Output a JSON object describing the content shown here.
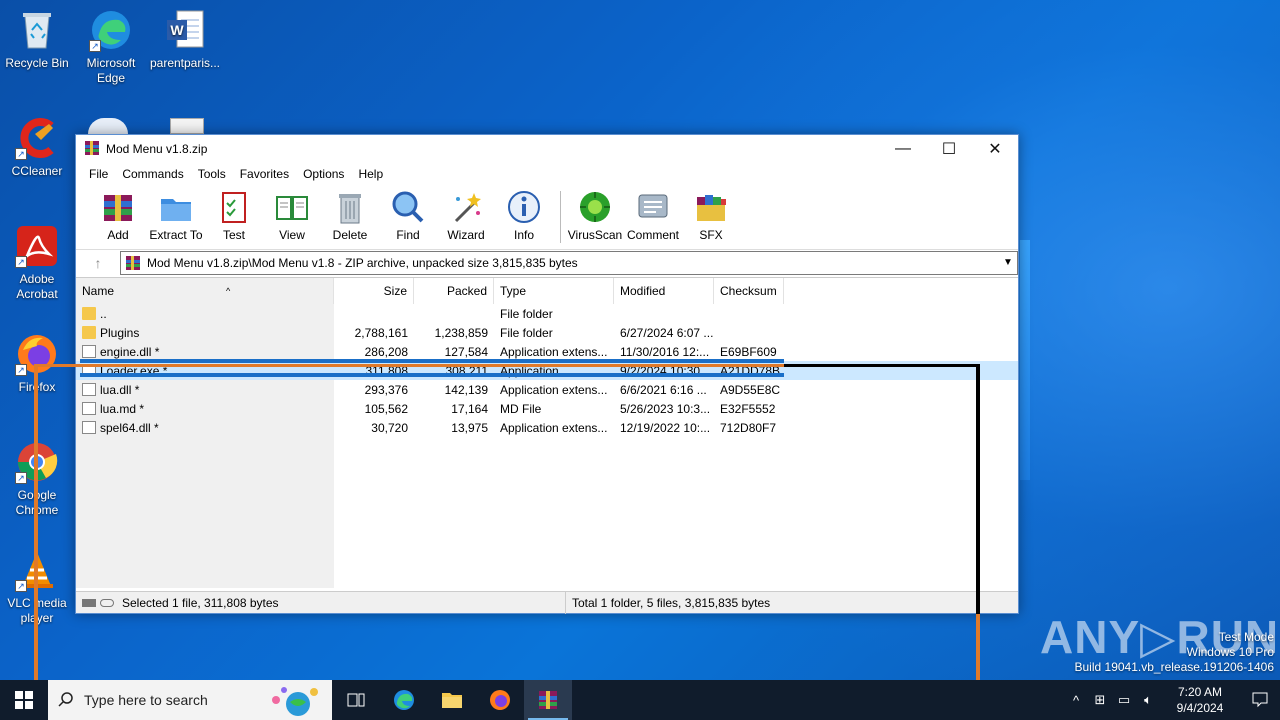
{
  "desktop": {
    "icons": [
      {
        "label": "Recycle Bin",
        "icon": "recycle-bin-icon"
      },
      {
        "label": "Microsoft Edge",
        "icon": "edge-icon"
      },
      {
        "label": "parentparis...",
        "icon": "word-doc-icon"
      },
      {
        "label": "CCleaner",
        "icon": "ccleaner-icon"
      },
      {
        "label": "Adobe Acrobat",
        "icon": "acrobat-icon"
      },
      {
        "label": "Firefox",
        "icon": "firefox-icon"
      },
      {
        "label": "Google Chrome",
        "icon": "chrome-icon"
      },
      {
        "label": "VLC media player",
        "icon": "vlc-icon"
      }
    ]
  },
  "window": {
    "title": "Mod Menu v1.8.zip",
    "controls": {
      "minimize": "—",
      "maximize": "☐",
      "close": "✕"
    },
    "menu": [
      "File",
      "Commands",
      "Tools",
      "Favorites",
      "Options",
      "Help"
    ],
    "toolbar": [
      "Add",
      "Extract To",
      "Test",
      "View",
      "Delete",
      "Find",
      "Wizard",
      "Info",
      "VirusScan",
      "Comment",
      "SFX"
    ],
    "address": "Mod Menu v1.8.zip\\Mod Menu v1.8 - ZIP archive, unpacked size 3,815,835 bytes",
    "columns": [
      "Name",
      "Size",
      "Packed",
      "Type",
      "Modified",
      "Checksum"
    ],
    "rows": [
      {
        "name": "..",
        "size": "",
        "packed": "",
        "type": "File folder",
        "modified": "",
        "checksum": "",
        "kind": "folder"
      },
      {
        "name": "Plugins",
        "size": "2,788,161",
        "packed": "1,238,859",
        "type": "File folder",
        "modified": "6/27/2024 6:07 ...",
        "checksum": "",
        "kind": "folder"
      },
      {
        "name": "engine.dll *",
        "size": "286,208",
        "packed": "127,584",
        "type": "Application extens...",
        "modified": "11/30/2016 12:...",
        "checksum": "E69BF609",
        "kind": "file"
      },
      {
        "name": "Loader.exe *",
        "size": "311,808",
        "packed": "308,211",
        "type": "Application",
        "modified": "9/2/2024 10:30 ...",
        "checksum": "A21DD78B",
        "kind": "file"
      },
      {
        "name": "lua.dll *",
        "size": "293,376",
        "packed": "142,139",
        "type": "Application extens...",
        "modified": "6/6/2021 6:16 ...",
        "checksum": "A9D55E8C",
        "kind": "file"
      },
      {
        "name": "lua.md *",
        "size": "105,562",
        "packed": "17,164",
        "type": "MD File",
        "modified": "5/26/2023 10:3...",
        "checksum": "E32F5552",
        "kind": "file"
      },
      {
        "name": "spel64.dll *",
        "size": "30,720",
        "packed": "13,975",
        "type": "Application extens...",
        "modified": "12/19/2022 10:...",
        "checksum": "712D80F7",
        "kind": "file"
      }
    ],
    "status_left": "Selected 1 file, 311,808 bytes",
    "status_right": "Total 1 folder, 5 files, 3,815,835 bytes"
  },
  "taskbar": {
    "search_placeholder": "Type here to search",
    "time": "7:20 AM",
    "date": "9/4/2024"
  },
  "watermark": {
    "brand": "ANY▷RUN",
    "line1": "Test Mode",
    "line2": "Windows 10 Pro",
    "line3": "Build 19041.vb_release.191206-1406"
  },
  "colors": {
    "overlay_orange": "#e07a2a",
    "overlay_blue": "#1a6fc8",
    "overlay_black": "#000000",
    "selection": "#cce8ff"
  }
}
